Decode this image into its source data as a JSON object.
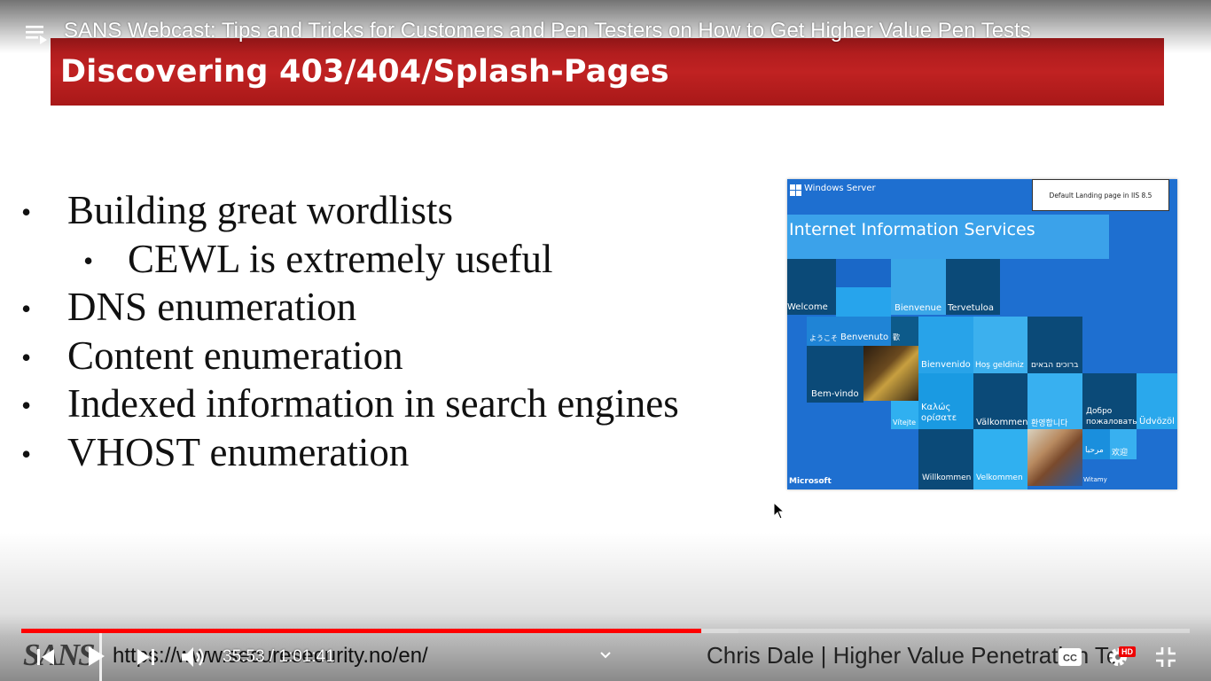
{
  "player": {
    "video_title": "SANS Webcast: Tips and Tricks for Customers and Pen Testers on How to Get Higher Value Pen Tests",
    "time_current": "35:53",
    "time_separator": " / ",
    "time_total": "1:01:41",
    "progress_fraction": 0.5817,
    "buffered_fraction": 0.614,
    "hd_badge": "HD",
    "accent_color": "#ff0000"
  },
  "slide": {
    "title": "Discovering 403/404/Splash-Pages",
    "bullets": [
      {
        "text": "Building great wordlists",
        "level": 1
      },
      {
        "text": "CEWL  is extremely useful",
        "level": 2
      },
      {
        "text": "DNS enumeration",
        "level": 1
      },
      {
        "text": "Content enumeration",
        "level": 1
      },
      {
        "text": "Indexed information in search engines",
        "level": 1
      },
      {
        "text": "VHOST enumeration",
        "level": 1
      }
    ],
    "bullet_glyph": "•",
    "title_bar_color": "#b31d1d"
  },
  "iis_image": {
    "brand": "Windows Server",
    "note": "Default Landing page in IIS 8.5",
    "title": "Internet Information Services",
    "greetings": {
      "welcome": "Welcome",
      "bienvenue": "Bienvenue",
      "tervetuloa": "Tervetuloa",
      "yokoso": "ようこそ",
      "benvenuto": "Benvenuto",
      "kanying": "歡",
      "bienvenido": "Bienvenido",
      "hos_geldiniz": "Hoş geldiniz",
      "hebrew": "ברוכים הבאים",
      "bem_vindo": "Bem-vindo",
      "kalos": "Καλώς ορίσατε",
      "vitejte": "Vítejte",
      "valkommen": "Välkommen",
      "korean": "환영합니다",
      "russian": "Добро пожаловать",
      "udvozol": "Üdvözöl",
      "arabic": "مرحبا",
      "chinese": "欢迎",
      "willkommen": "Willkommen",
      "velkommen": "Velkommen",
      "witamy": "Witamy"
    },
    "vendor": "Microsoft"
  },
  "lower_third": {
    "logo": "SANS",
    "url": "https://www.securesecurity.no/en/",
    "presenter": "Chris Dale  |   Higher Value Penetration Te"
  }
}
